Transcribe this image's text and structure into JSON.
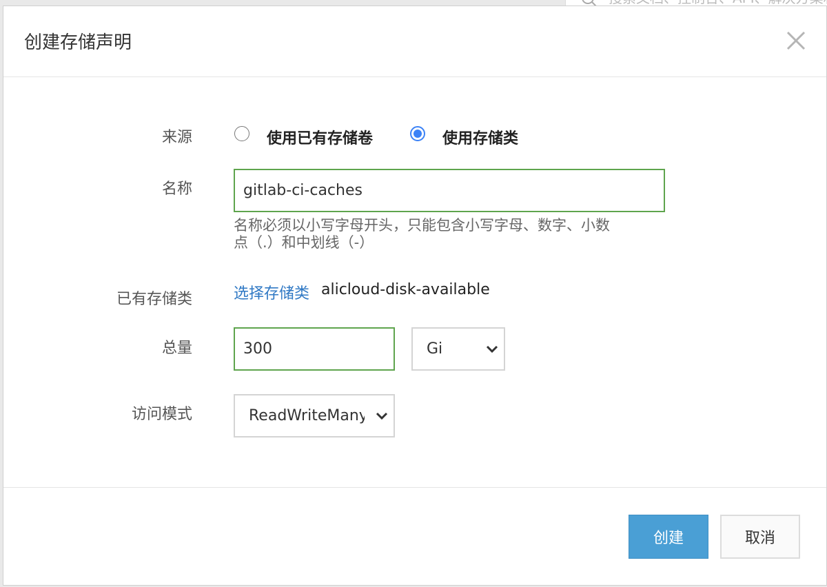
{
  "background": {
    "search_placeholder": "搜索文档、控制台、API、解决方案和资源"
  },
  "dialog": {
    "title": "创建存储声明",
    "close_icon": "close-icon"
  },
  "form": {
    "source": {
      "label": "来源",
      "options": [
        {
          "label": "使用已有存储卷",
          "checked": false
        },
        {
          "label": "使用存储类",
          "checked": true
        }
      ]
    },
    "name": {
      "label": "名称",
      "value": "gitlab-ci-caches",
      "help_line1": "名称必须以小写字母开头，只能包含小写字母、数字、小数",
      "help_line2": "点（.）和中划线（-）"
    },
    "storage_class": {
      "label": "已有存储类",
      "link_text": "选择存储类",
      "value": "alicloud-disk-available"
    },
    "capacity": {
      "label": "总量",
      "value": "300",
      "unit": "Gi"
    },
    "access_mode": {
      "label": "访问模式",
      "value": "ReadWriteMany"
    }
  },
  "footer": {
    "create_label": "创建",
    "cancel_label": "取消"
  },
  "colors": {
    "primary": "#4a9fd5",
    "link": "#2f78c4",
    "input_valid_border": "#5ea44d",
    "radio_checked": "#3b82f6"
  }
}
